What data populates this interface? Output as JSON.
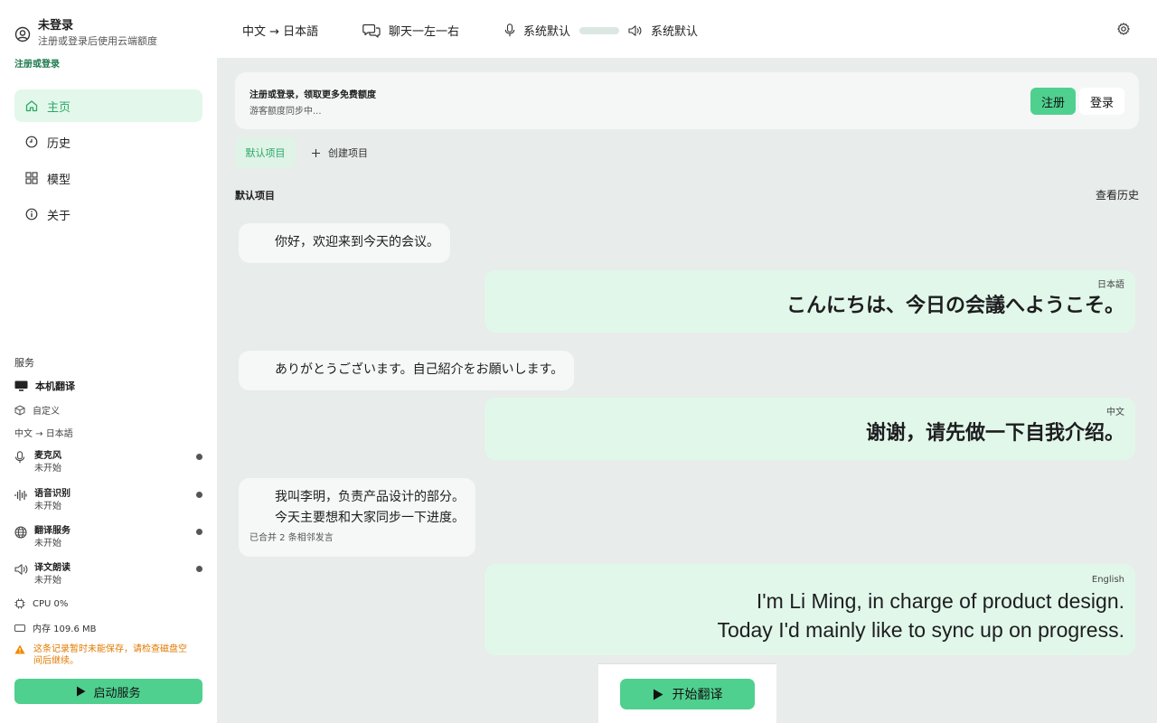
{
  "user": {
    "name": "未登录",
    "subtitle": "注册或登录后使用云端额度",
    "login_link": "注册或登录"
  },
  "nav": {
    "items": [
      {
        "label": "主页",
        "icon": "home-icon",
        "active": true
      },
      {
        "label": "历史",
        "icon": "clock-icon",
        "active": false
      },
      {
        "label": "模型",
        "icon": "grid-icon",
        "active": false
      },
      {
        "label": "关于",
        "icon": "info-icon",
        "active": false
      }
    ]
  },
  "services": {
    "title": "服务",
    "local_translation": "本机翻译",
    "custom": "自定义",
    "language_pair": "中文 → 日本語",
    "items": [
      {
        "name": "麦克风",
        "status": "未开始",
        "icon": "microphone-icon"
      },
      {
        "name": "语音识别",
        "status": "未开始",
        "icon": "waveform-icon"
      },
      {
        "name": "翻译服务",
        "status": "未开始",
        "icon": "globe-icon"
      },
      {
        "name": "译文朗读",
        "status": "未开始",
        "icon": "speaker-icon"
      }
    ],
    "cpu": "CPU 0%",
    "memory": "内存 109.6 MB",
    "warning": "这条记录暂时未能保存，请检查磁盘空间后继续。",
    "start_button": "启动服务"
  },
  "topbar": {
    "language_pair": "中文 → 日本語",
    "layout_mode": "聊天一左一右",
    "mic_device": "系统默认",
    "speaker_device": "系统默认"
  },
  "banner": {
    "title": "注册或登录，领取更多免费额度",
    "subtitle": "游客额度同步中...",
    "register_label": "注册",
    "login_label": "登录"
  },
  "tabs": {
    "default_project": "默认项目",
    "create_project": "创建项目"
  },
  "project": {
    "title": "默认项目",
    "view_history": "查看历史"
  },
  "messages": [
    {
      "source_lines": [
        "你好，欢迎来到今天的会议。"
      ],
      "target_lang": "日本語",
      "target_lines": [
        "こんにちは、今日の会議へようこそ。"
      ]
    },
    {
      "source_lines": [
        "ありがとうございます。自己紹介をお願いします。"
      ],
      "target_lang": "中文",
      "target_lines": [
        "谢谢，请先做一下自我介绍。"
      ]
    },
    {
      "source_lines": [
        "我叫李明，负责产品设计的部分。",
        "今天主要想和大家同步一下进度。"
      ],
      "source_note": "已合并 2 条相邻发言",
      "target_lang": "English",
      "target_lines": [
        "I'm Li Ming, in charge of product design.",
        "Today I'd mainly like to sync up on progress."
      ]
    }
  ],
  "start_translate": "开始翻译",
  "colors": {
    "accent": "#4fd08f",
    "accent_text": "#2ba868",
    "main_bg": "#e8ecea",
    "target_bubble": "#e1f7ea",
    "warning": "#e07b00"
  }
}
